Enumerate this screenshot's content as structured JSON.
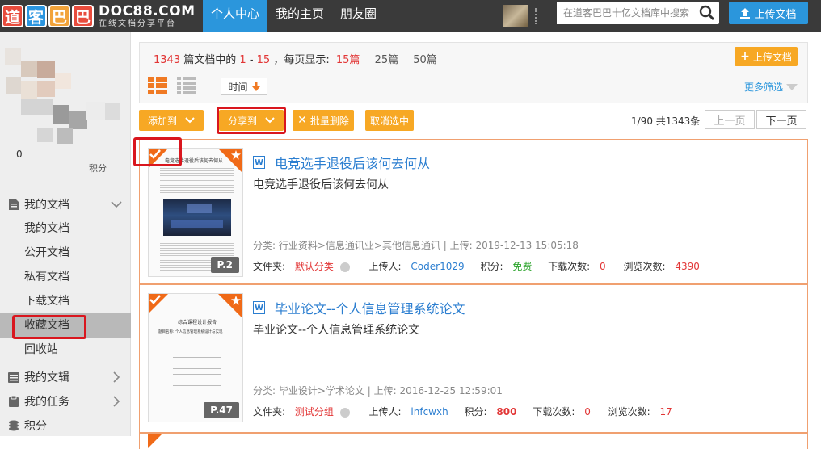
{
  "header": {
    "logo_chars": [
      "道",
      "客",
      "巴",
      "巴"
    ],
    "logo_domain": "DOC88.COM",
    "logo_tagline": "在线文档分享平台",
    "nav": [
      "个人中心",
      "我的主页",
      "朋友圈"
    ],
    "search_placeholder": "在道客巴巴十亿文档库中搜索...",
    "upload_label": "上传文档"
  },
  "sidebar": {
    "zero": "0",
    "points_label": "积分",
    "my_docs": "我的文档",
    "doc_items": [
      "我的文档",
      "公开文档",
      "私有文档",
      "下载文档",
      "收藏文档",
      "回收站"
    ],
    "sections": [
      "我的文辑",
      "我的任务",
      "积分"
    ]
  },
  "stats": {
    "total": "1343",
    "text_a": "篇文档中的",
    "range_start": "1",
    "dash": "-",
    "range_end": "15",
    "text_b": "，每页显示:",
    "per_page": [
      "15篇",
      "25篇",
      "50篇"
    ],
    "upload_label": "上传文档",
    "sort_label": "时间",
    "more_filter": "更多筛选"
  },
  "toolbar": {
    "add_to": "添加到",
    "share_to": "分享到",
    "batch_delete": "批量删除",
    "cancel_select": "取消选中",
    "page_current": "1",
    "page_rest": "/90 共1343条",
    "prev": "上一页",
    "next": "下一页"
  },
  "docs": [
    {
      "title": "电竞选手退役后该何去何从",
      "desc": "电竞选手退役后该何去何从",
      "category": "分类: 行业资料>信息通讯业>其他信息通讯 | 上传: 2019-12-13 15:05:18",
      "folder_label": "文件夹:",
      "folder": "默认分类",
      "uploader_label": "上传人:",
      "uploader": "Coder1029",
      "points_label": "积分:",
      "points": "免费",
      "downloads_label": "下载次数:",
      "downloads": "0",
      "views_label": "浏览次数:",
      "views": "4390",
      "pages": "P.2",
      "thumb_heading": "电竞选手退役后该何去何从"
    },
    {
      "title": "毕业论文--个人信息管理系统论文",
      "desc": "毕业论文--个人信息管理系统论文",
      "category": "分类: 毕业设计>学术论文 | 上传: 2016-12-25 12:59:01",
      "folder_label": "文件夹:",
      "folder": "测试分组",
      "uploader_label": "上传人:",
      "uploader": "lnfcwxh",
      "points_label": "积分:",
      "points": "800",
      "downloads_label": "下载次数:",
      "downloads": "0",
      "views_label": "浏览次数:",
      "views": "17",
      "pages": "P.47",
      "thumb_heading": "综合课程设计报告",
      "thumb_sub": "题目名称: 个人信息管理系统设计与实现"
    }
  ],
  "colors": {
    "accent": "#2b96dc",
    "orange": "#f7a824",
    "highlight": "#d9161e",
    "topbar": "#3a3a3a"
  }
}
